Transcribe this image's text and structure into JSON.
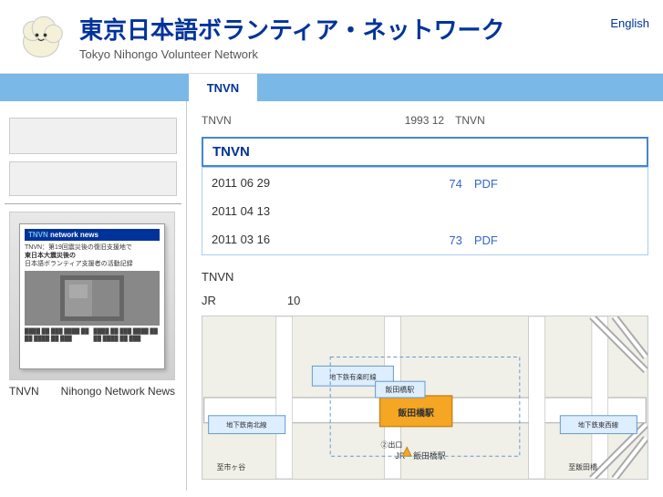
{
  "header": {
    "site_title": "東京日本語ボランティア・ネットワーク",
    "site_subtitle": "Tokyo Nihongo Volunteer Network",
    "lang_label": "English"
  },
  "navbar": {
    "items": [
      {
        "label": "",
        "active": false
      },
      {
        "label": "",
        "active": false
      },
      {
        "label": "",
        "active": false
      },
      {
        "label": "TNVN",
        "active": true
      },
      {
        "label": "",
        "active": false
      },
      {
        "label": "",
        "active": false
      }
    ]
  },
  "breadcrumb": {
    "home": "TNVN",
    "sep": "　",
    "current": "TNVN",
    "info": "1993 12　TNVN"
  },
  "tnvn_section": {
    "title": "TNVN",
    "rows": [
      {
        "date": "2011 06 29",
        "num": "74",
        "pdf_label": "PDF",
        "has_pdf": true
      },
      {
        "date": "2011 04 13",
        "num": "",
        "pdf_label": "",
        "has_pdf": false
      },
      {
        "date": "2011 03 16",
        "num": "73",
        "pdf_label": "PDF",
        "has_pdf": true
      }
    ]
  },
  "location_section": {
    "title": "TNVN",
    "detail": "JR　　　　　　10"
  },
  "sidebar": {
    "news_caption": "TNVN　　Nihongo Network News"
  }
}
